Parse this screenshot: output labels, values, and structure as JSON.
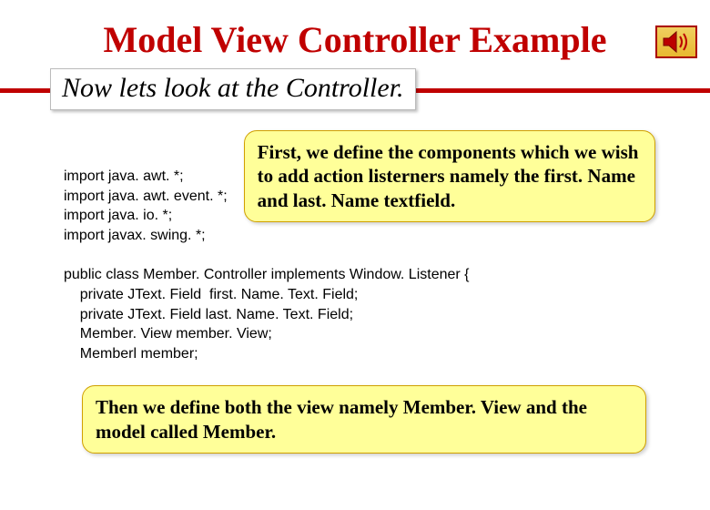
{
  "title": "Model View Controller Example",
  "subtitle": "Now lets look at the Controller.",
  "imports": {
    "line1": "import java. awt. *;",
    "line2": "import java. awt. event. *;",
    "line3": "import java. io. *;",
    "line4": "import javax. swing. *;"
  },
  "callout1": "First, we define the components which we wish to add action listerners namely the first. Name and last. Name textfield.",
  "class_code": {
    "line1": "public class Member. Controller implements Window. Listener {",
    "line2": "    private JText. Field  first. Name. Text. Field;",
    "line3": "    private JText. Field last. Name. Text. Field;",
    "line4": "    Member. View member. View;",
    "line5": "    Memberl member;"
  },
  "callout2": "Then we define both the view namely Member. View and the model called Member."
}
